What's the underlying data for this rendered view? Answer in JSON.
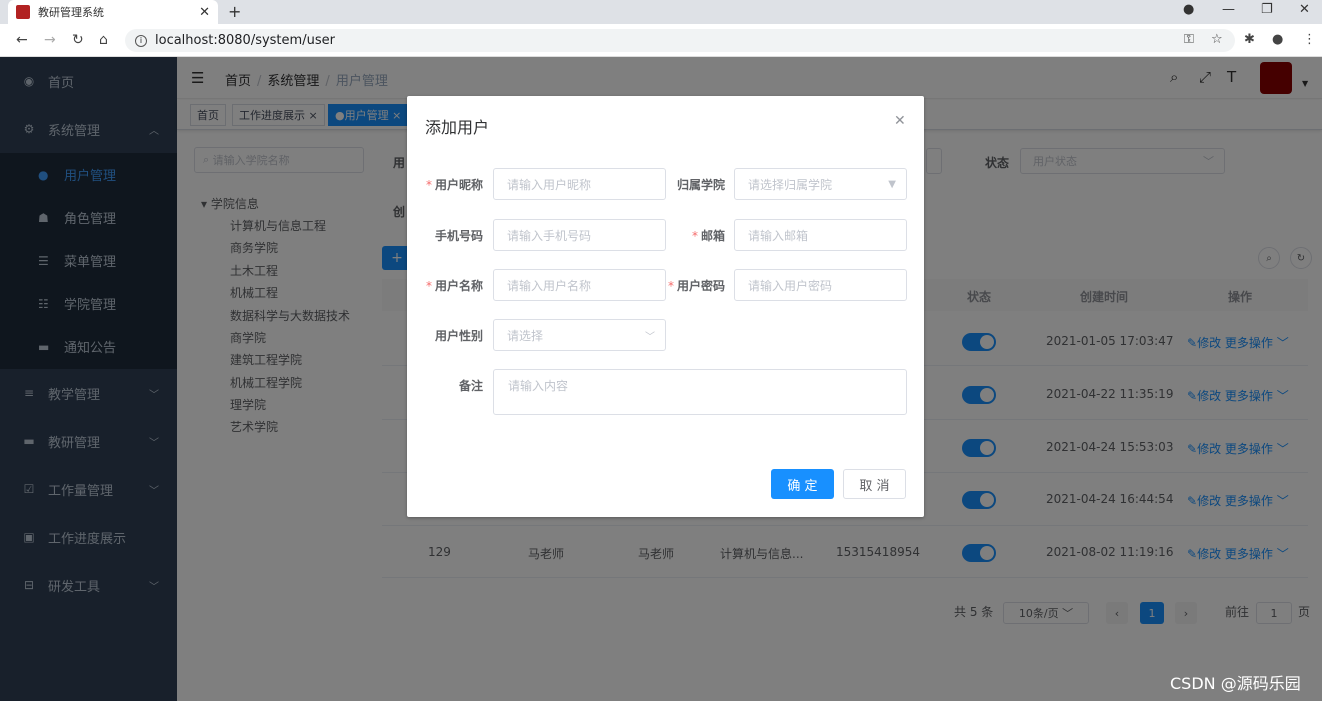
{
  "browser": {
    "tab_title": "教研管理系统",
    "url": "localhost:8080/system/user"
  },
  "sidebar": {
    "items": [
      {
        "label": "首页",
        "icon": "dashboard-icon"
      },
      {
        "label": "系统管理",
        "icon": "gear-icon"
      },
      {
        "label": "教学管理",
        "icon": "sliders-icon"
      },
      {
        "label": "教研管理",
        "icon": "chat-icon"
      },
      {
        "label": "工作量管理",
        "icon": "checkbox-icon"
      },
      {
        "label": "工作进度展示",
        "icon": "board-icon"
      },
      {
        "label": "研发工具",
        "icon": "toolbox-icon"
      }
    ],
    "sub_items": [
      {
        "label": "用户管理",
        "icon": "user-icon"
      },
      {
        "label": "角色管理",
        "icon": "peoples-icon"
      },
      {
        "label": "菜单管理",
        "icon": "tree-table-icon"
      },
      {
        "label": "学院管理",
        "icon": "tree-icon"
      },
      {
        "label": "通知公告",
        "icon": "message-icon"
      }
    ]
  },
  "navbar": {
    "breadcrumb": [
      "首页",
      "系统管理",
      "用户管理"
    ]
  },
  "tags": [
    "首页",
    "工作进度展示",
    "用户管理"
  ],
  "tree": {
    "search_placeholder": "请输入学院名称",
    "root": "学院信息",
    "nodes": [
      "计算机与信息工程",
      "商务学院",
      "土木工程",
      "机械工程",
      "数据科学与大数据技术",
      "商学院",
      "建筑工程学院",
      "机械工程学院",
      "理学院",
      "艺术学院"
    ]
  },
  "filters": {
    "user_label_partial": "用",
    "created_label_partial": "创",
    "status_label": "状态",
    "status_placeholder": "用户状态"
  },
  "table": {
    "headers": {
      "status": "状态",
      "created": "创建时间",
      "ops": "操作"
    },
    "rows": [
      {
        "created": "2021-01-05 17:03:47"
      },
      {
        "created": "2021-04-22 11:35:19"
      },
      {
        "created": "2021-04-24 15:53:03"
      },
      {
        "created": "2021-04-24 16:44:54"
      },
      {
        "id": "129",
        "username": "马老师",
        "nickname": "马老师",
        "college": "计算机与信息...",
        "phone": "15315418954",
        "created": "2021-08-02 11:19:16"
      }
    ],
    "edit_label": "修改",
    "more_label": "更多操作"
  },
  "pagination": {
    "total": "共 5 条",
    "page_size": "10条/页",
    "current": "1",
    "goto_prefix": "前往",
    "goto_value": "1",
    "goto_suffix": "页"
  },
  "dialog": {
    "title": "添加用户",
    "fields": {
      "nickname_label": "用户昵称",
      "nickname_placeholder": "请输入用户昵称",
      "college_label": "归属学院",
      "college_placeholder": "请选择归属学院",
      "phone_label": "手机号码",
      "phone_placeholder": "请输入手机号码",
      "email_label": "邮箱",
      "email_placeholder": "请输入邮箱",
      "username_label": "用户名称",
      "username_placeholder": "请输入用户名称",
      "password_label": "用户密码",
      "password_placeholder": "请输入用户密码",
      "gender_label": "用户性别",
      "gender_placeholder": "请选择",
      "remark_label": "备注",
      "remark_placeholder": "请输入内容"
    },
    "confirm": "确 定",
    "cancel": "取 消"
  },
  "watermark": "CSDN @源码乐园",
  "colors": {
    "primary": "#1890ff",
    "sidebar": "#304156",
    "danger": "#f56c6c"
  }
}
